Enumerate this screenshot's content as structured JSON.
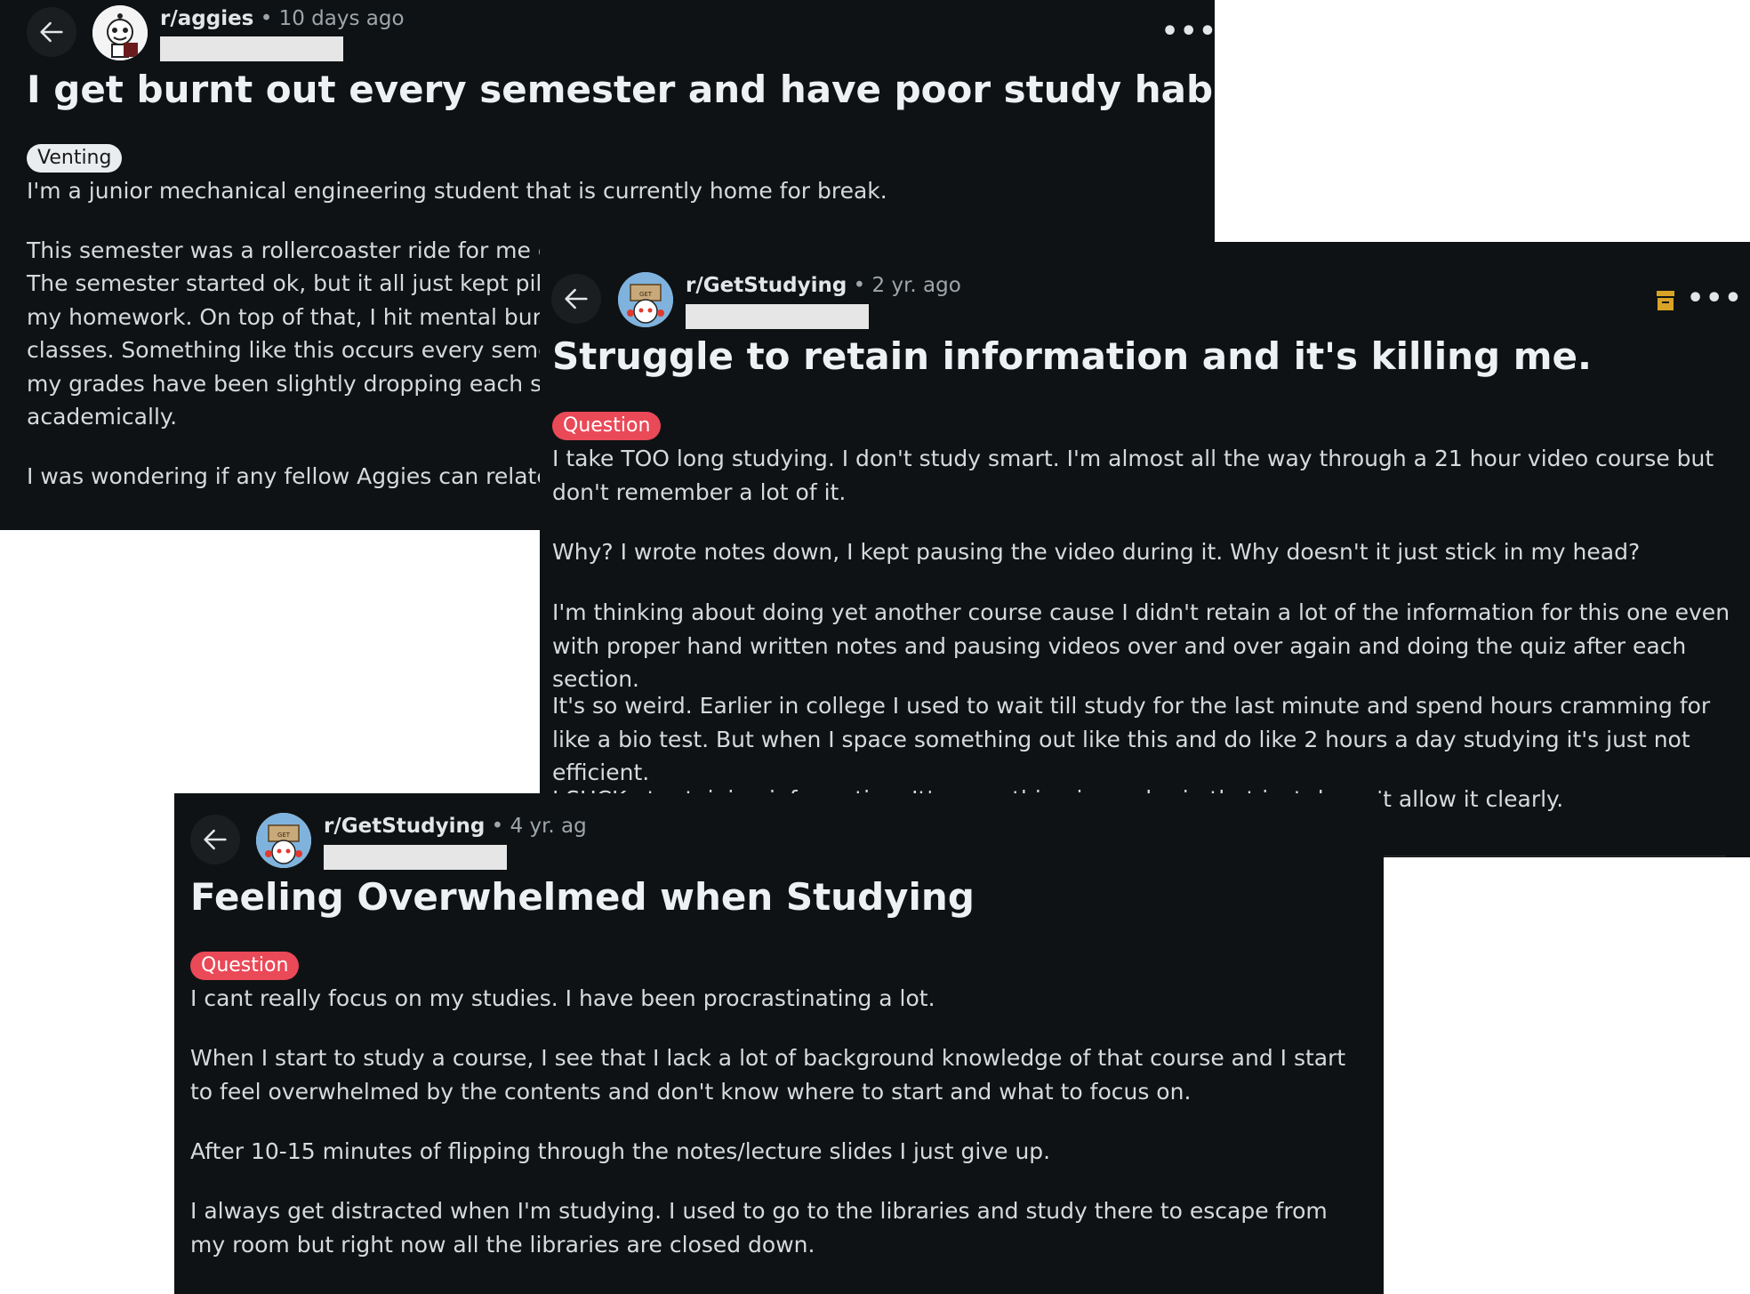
{
  "posts": [
    {
      "subreddit": "r/aggies",
      "age": "10 days ago",
      "title": "I get burnt out every semester and have poor study habits",
      "flair": "Venting",
      "paragraphs": [
        "I'm a junior mechanical engineering student that is currently home for break.",
        "This semester was a rollercoaster ride for me emot",
        "The semester started ok, but it all just kept piling u",
        "my homework. On top of that, I hit mental burnou",
        "classes. Something like this occurs every semester,",
        "my grades have been slightly dropping each seme",
        "academically.",
        "I was wondering if any fellow Aggies can relate or"
      ],
      "icons": {
        "back": "arrow-left-icon",
        "more": "more-options-icon",
        "avatar": "aggies-avatar-icon"
      }
    },
    {
      "subreddit": "r/GetStudying",
      "age": "2 yr. ago",
      "title": "Struggle to retain information and it's killing me.",
      "flair": "Question",
      "paragraphs": [
        "I take TOO long studying. I don't study smart. I'm almost all the way through a 21 hour video course but don't remember a lot of it.",
        "Why? I wrote notes down, I kept pausing the video during it. Why doesn't it just stick in my head?",
        "I'm thinking about doing yet another course cause I didn't retain a lot of the information for this one even with proper hand written notes and pausing videos over and over again and doing the quiz after each section.",
        "It's so weird. Earlier in college I used to wait till study for the last minute and spend hours cramming for like a bio test. But when I space something out like this and do like 2 hours a day studying it's just not efficient.",
        "I SUCK at retaining information. It's something in my brain that just doesn't allow it clearly."
      ],
      "icons": {
        "back": "arrow-left-icon",
        "more": "more-options-icon",
        "archive": "archive-icon",
        "avatar": "getstudying-avatar-icon"
      },
      "colors": {
        "archive": "#d9a326"
      }
    },
    {
      "subreddit": "r/GetStudying",
      "age": "4 yr. ag",
      "title": "Feeling Overwhelmed when Studying",
      "flair": "Question",
      "paragraphs": [
        "I cant really focus on my studies. I have been procrastinating a lot.",
        "When I start to study a course, I see that I lack a lot of background knowledge of that course and I start to feel overwhelmed by the contents and don't know where to start and what to focus on.",
        "After 10-15 minutes of flipping through the notes/lecture slides I just give up.",
        "I always get distracted when I'm studying. I used to go to the libraries and study there to escape from my room but right now all the libraries are closed down."
      ],
      "icons": {
        "back": "arrow-left-icon",
        "avatar": "getstudying-avatar-icon"
      }
    }
  ],
  "colors": {
    "card_bg": "#0f1214",
    "question_flair": "#ea4957",
    "venting_flair": "#eaedef"
  }
}
